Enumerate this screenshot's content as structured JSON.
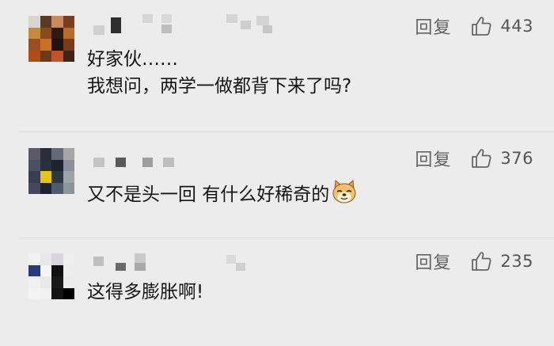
{
  "comments": [
    {
      "reply_label": "回复",
      "likes": "443",
      "lines": [
        "好家伙……",
        "我想问，两学一做都背下来了吗?"
      ],
      "avatar_colors": [
        "#d9d7cd",
        "#5a3b22",
        "#ca8a5e",
        "#7a3d1f",
        "#c48a3d",
        "#8b4a1c",
        "#2b1a12",
        "#b86d2a",
        "#9a4e22",
        "#c9711f",
        "#1d1410",
        "#7b3a1a",
        "#b04d16",
        "#6a3a1e",
        "#c8512a",
        "#3e2616"
      ]
    },
    {
      "reply_label": "回复",
      "likes": "376",
      "lines": [
        "又不是头一回 有什么好稀奇的"
      ],
      "emoji": "doge-emoji",
      "avatar_colors": [
        "#5b5a66",
        "#2b2d3a",
        "#606a78",
        "#a6a6a6",
        "#4b4f63",
        "#28303d",
        "#1f2331",
        "#8b8f99",
        "#3a3d52",
        "#e6c415",
        "#2d3645",
        "#9ea3aa",
        "#45485c",
        "#1d2230",
        "#4e5b6e",
        "#8c949c"
      ]
    },
    {
      "reply_label": "回复",
      "likes": "235",
      "lines": [
        "这得多膨胀啊!"
      ],
      "avatar_colors": [
        "#f2f2f2",
        "#e7e7ea",
        "#d8d5de",
        "#efefef",
        "#2a3a7a",
        "#f4f4f4",
        "#111111",
        "#ededed",
        "#f0f0f0",
        "#e9e9e9",
        "#1a1a1a",
        "#ebebeb",
        "#f3f3f3",
        "#f1f1f1",
        "#141414",
        "#000000"
      ]
    }
  ]
}
